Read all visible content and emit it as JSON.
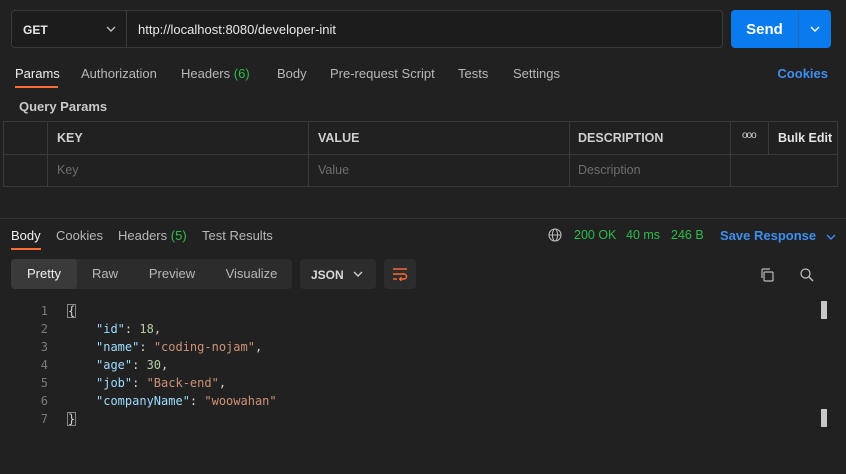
{
  "request": {
    "method": "GET",
    "url": "http://localhost:8080/developer-init",
    "send_label": "Send"
  },
  "request_tabs": {
    "params": "Params",
    "authorization": "Authorization",
    "headers": "Headers",
    "headers_count": "(6)",
    "body": "Body",
    "prerequest": "Pre-request Script",
    "tests": "Tests",
    "settings": "Settings",
    "cookies": "Cookies"
  },
  "query_params": {
    "title": "Query Params",
    "columns": {
      "key": "KEY",
      "value": "VALUE",
      "description": "DESCRIPTION",
      "more": "ooo",
      "bulk_edit": "Bulk Edit"
    },
    "placeholders": {
      "key": "Key",
      "value": "Value",
      "description": "Description"
    }
  },
  "response_tabs": {
    "body": "Body",
    "cookies": "Cookies",
    "headers": "Headers",
    "headers_count": "(5)",
    "test_results": "Test Results"
  },
  "response_status": {
    "status": "200 OK",
    "time": "40 ms",
    "size": "246 B",
    "save_label": "Save Response"
  },
  "view_tabs": {
    "pretty": "Pretty",
    "raw": "Raw",
    "preview": "Preview",
    "visualize": "Visualize"
  },
  "format": "JSON",
  "code": {
    "line_numbers": [
      "1",
      "2",
      "3",
      "4",
      "5",
      "6",
      "7"
    ],
    "open_brace": "{",
    "close_brace": "}",
    "fields": [
      {
        "key": "\"id\"",
        "value": "18",
        "type": "number",
        "trail": ","
      },
      {
        "key": "\"name\"",
        "value": "\"coding-nojam\"",
        "type": "string",
        "trail": ","
      },
      {
        "key": "\"age\"",
        "value": "30",
        "type": "number",
        "trail": ","
      },
      {
        "key": "\"job\"",
        "value": "\"Back-end\"",
        "type": "string",
        "trail": ","
      },
      {
        "key": "\"companyName\"",
        "value": "\"woowahan\"",
        "type": "string",
        "trail": ""
      }
    ]
  },
  "colors": {
    "accent_orange": "#ff6c37",
    "send_blue": "#097bed",
    "link_blue": "#3e8ef0",
    "success_green": "#2dbb4a"
  },
  "icons": [
    "chevron-down-icon",
    "globe-icon",
    "wrap-lines-icon",
    "copy-icon",
    "search-icon"
  ]
}
